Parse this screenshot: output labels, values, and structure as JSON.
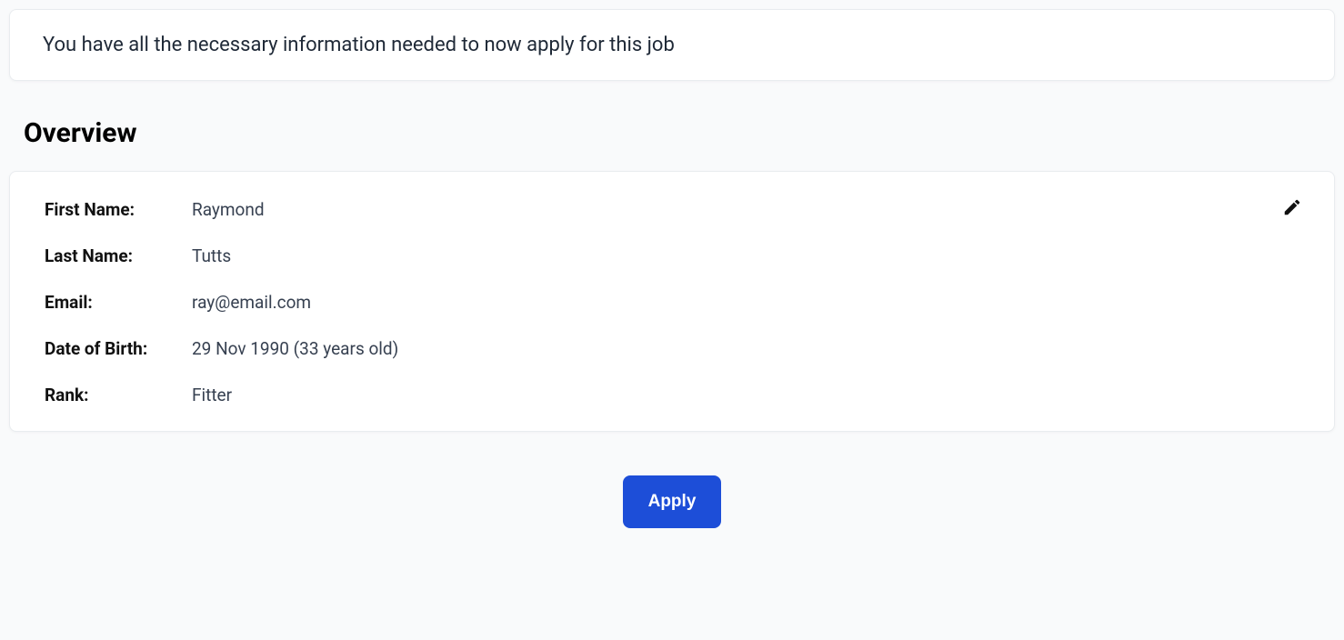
{
  "banner": {
    "message": "You have all the necessary information needed to now apply for this job"
  },
  "overview": {
    "title": "Overview",
    "fields": {
      "firstName": {
        "label": "First Name:",
        "value": "Raymond"
      },
      "lastName": {
        "label": "Last Name:",
        "value": "Tutts"
      },
      "email": {
        "label": "Email:",
        "value": "ray@email.com"
      },
      "dob": {
        "label": "Date of Birth:",
        "value": "29 Nov 1990 (33 years old)"
      },
      "rank": {
        "label": "Rank:",
        "value": "Fitter"
      }
    }
  },
  "actions": {
    "apply": "Apply"
  }
}
